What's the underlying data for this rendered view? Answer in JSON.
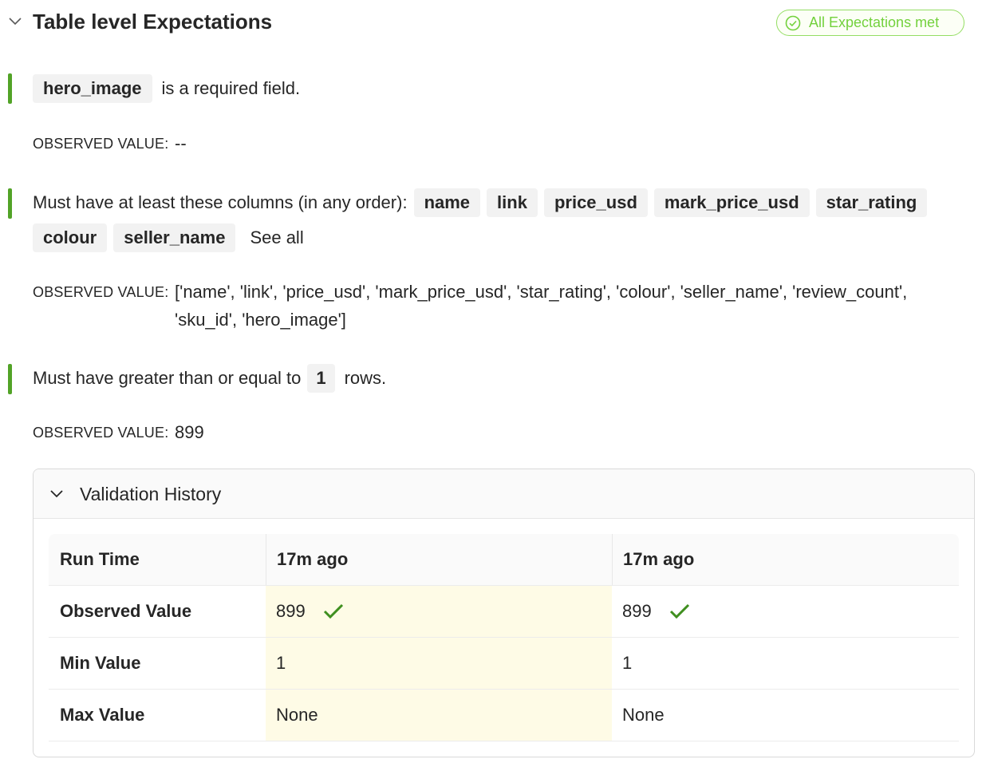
{
  "section": {
    "title": "Table level Expectations",
    "status_badge": "All Expectations met",
    "accent_color": "#52a327",
    "badge_color": "#73d13d"
  },
  "expectations": [
    {
      "chips": [
        "hero_image"
      ],
      "text": "is a required field.",
      "observed_label": "OBSERVED VALUE:",
      "observed_value": "--"
    },
    {
      "text": "Must have at least these columns (in any order):",
      "chips": [
        "name",
        "link",
        "price_usd",
        "mark_price_usd",
        "star_rating",
        "colour",
        "seller_name"
      ],
      "see_all": "See all",
      "observed_label": "OBSERVED VALUE:",
      "observed_value_line1": "['name', 'link', 'price_usd', 'mark_price_usd', 'star_rating', 'colour', 'seller_name', 'review_count',",
      "observed_value_line2": "'sku_id', 'hero_image']"
    },
    {
      "text_before": "Must have greater than or equal to",
      "chip": "1",
      "text_after": "rows.",
      "observed_label": "OBSERVED VALUE:",
      "observed_value": "899"
    }
  ],
  "validation_history": {
    "title": "Validation History",
    "rows": [
      {
        "label": "Run Time",
        "values": [
          "17m ago",
          "17m ago"
        ]
      },
      {
        "label": "Observed Value",
        "values": [
          "899",
          "899"
        ]
      },
      {
        "label": "Min Value",
        "values": [
          "1",
          "1"
        ]
      },
      {
        "label": "Max Value",
        "values": [
          "None",
          "None"
        ]
      }
    ],
    "highlight_color": "#fefbe6",
    "check_color": "#3f8f1f"
  }
}
